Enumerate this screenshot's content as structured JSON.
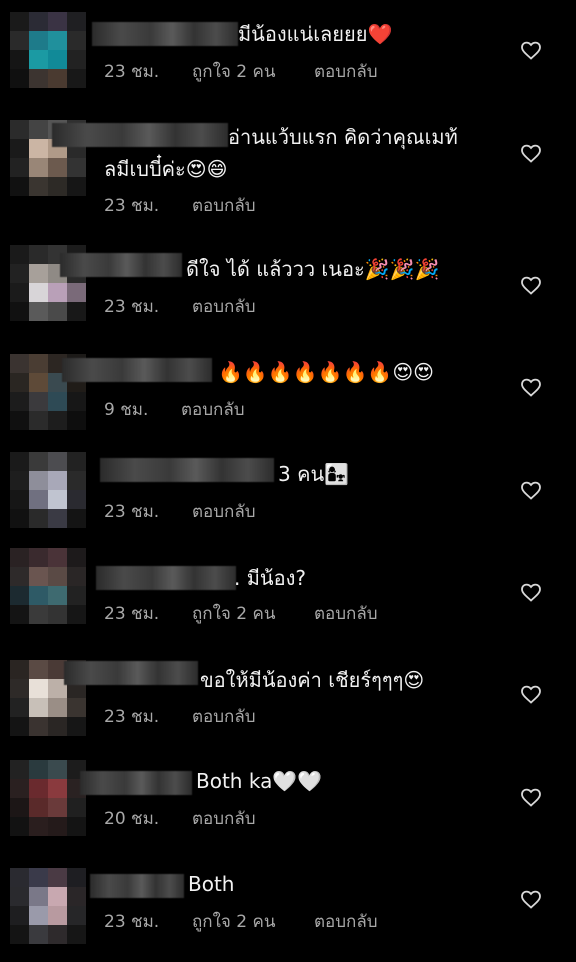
{
  "comments": [
    {
      "text": "มีน้องแน่เลยยย❤️",
      "time": "23 ชม.",
      "likes": "ถูกใจ 2 คน",
      "reply": "ตอบกลับ"
    },
    {
      "text": "อ่านแว้บแรก คิดว่าคุณเมท้ลมีเบบี๋ค่ะ😍😄",
      "time": "23 ชม.",
      "likes": "",
      "reply": "ตอบกลับ"
    },
    {
      "text": "ดีใจ ได้ แล้ววว เนอะ🎉🎉🎉",
      "time": "23 ชม.",
      "likes": "",
      "reply": "ตอบกลับ"
    },
    {
      "text": "🔥🔥🔥🔥🔥🔥🔥😍😍",
      "time": "9 ชม.",
      "likes": "",
      "reply": "ตอบกลับ"
    },
    {
      "text": "3 คน👩‍👧",
      "time": "23 ชม.",
      "likes": "",
      "reply": "ตอบกลับ"
    },
    {
      "text": ". มีน้อง?",
      "time": "23 ชม.",
      "likes": "ถูกใจ 2 คน",
      "reply": "ตอบกลับ"
    },
    {
      "text": "ขอให้มีน้องค่า เชียร์ๆๆๆ😍",
      "time": "23 ชม.",
      "likes": "",
      "reply": "ตอบกลับ"
    },
    {
      "text": "Both ka🤍🤍",
      "time": "20 ชม.",
      "likes": "",
      "reply": "ตอบกลับ"
    },
    {
      "text": "Both",
      "time": "23 ชม.",
      "likes": "ถูกใจ 2 คน",
      "reply": "ตอบกลับ"
    }
  ],
  "colors": {
    "background": "#000000",
    "text": "#f2f2f2",
    "meta": "#a8a8a8",
    "icon": "#d8d8d8"
  },
  "icons": {
    "like": "heart-outline-icon"
  }
}
